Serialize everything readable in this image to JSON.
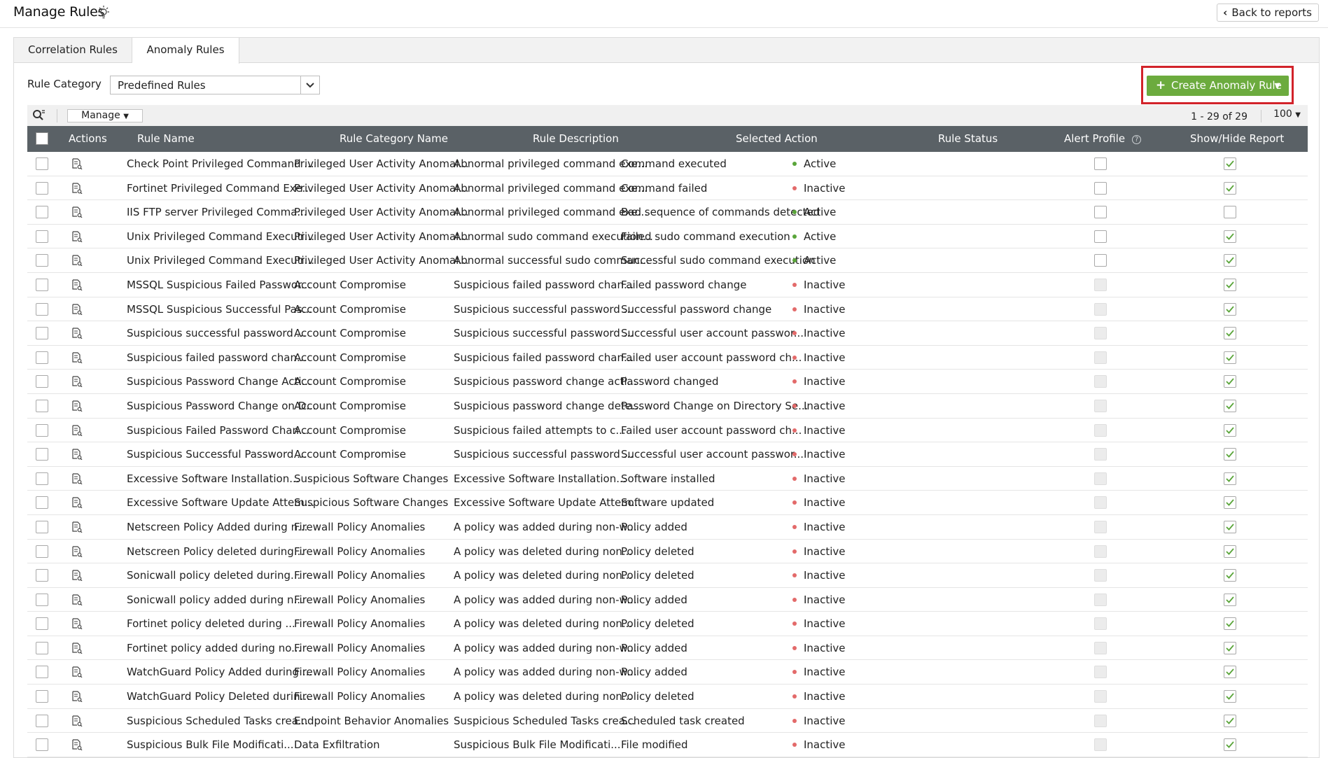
{
  "header": {
    "title": "Manage Rules",
    "back_label": "Back to reports"
  },
  "tabs": [
    {
      "label": "Correlation Rules",
      "active": false
    },
    {
      "label": "Anomaly Rules",
      "active": true
    }
  ],
  "filter": {
    "label": "Rule Category",
    "selected": "Predefined Rules"
  },
  "create_button": {
    "label": "Create Anomaly Rule",
    "color": "#6cab3e"
  },
  "toolbar": {
    "manage_label": "Manage",
    "pagination": "1 - 29 of 29",
    "per_page": "100"
  },
  "columns": {
    "actions": "Actions",
    "rule_name": "Rule Name",
    "category": "Rule Category Name",
    "description": "Rule Description",
    "action": "Selected Action",
    "status": "Rule Status",
    "alert": "Alert Profile",
    "show": "Show/Hide Report"
  },
  "colors": {
    "header_bg": "#5a6166",
    "active": "#5aa53a",
    "inactive": "#e36a6a",
    "check": "#5aa53a",
    "highlight": "#d2232a"
  },
  "rows": [
    {
      "name": "Check Point Privileged Command ...",
      "category": "Privileged User Activity Anomal...",
      "description": "Abnormal privileged command exe...",
      "action": "Command executed",
      "status": "Active",
      "alert_enabled": true,
      "show": true
    },
    {
      "name": "Fortinet Privileged Command Exe...",
      "category": "Privileged User Activity Anomal...",
      "description": "Abnormal privileged command exe...",
      "action": "Command failed",
      "status": "Inactive",
      "alert_enabled": true,
      "show": true
    },
    {
      "name": "IIS FTP server Privileged Comma...",
      "category": "Privileged User Activity Anomal...",
      "description": "Abnormal privileged command exe...",
      "action": "Bad sequence of commands detected",
      "status": "Active",
      "alert_enabled": true,
      "show": false
    },
    {
      "name": "Unix Privileged Command Executi...",
      "category": "Privileged User Activity Anomal...",
      "description": "Abnormal sudo command execution...",
      "action": "Failed sudo command execution",
      "status": "Active",
      "alert_enabled": true,
      "show": true
    },
    {
      "name": "Unix Privileged Command Executi...",
      "category": "Privileged User Activity Anomal...",
      "description": "Abnormal successful sudo comman...",
      "action": "Successful sudo command execution",
      "status": "Active",
      "alert_enabled": true,
      "show": true
    },
    {
      "name": "MSSQL Suspicious Failed Passwor...",
      "category": "Account Compromise",
      "description": "Suspicious failed password chan...",
      "action": "Failed password change",
      "status": "Inactive",
      "alert_enabled": false,
      "show": true
    },
    {
      "name": "MSSQL Suspicious Successful Pas...",
      "category": "Account Compromise",
      "description": "Suspicious successful password ...",
      "action": "Successful password change",
      "status": "Inactive",
      "alert_enabled": false,
      "show": true
    },
    {
      "name": "Suspicious successful password ...",
      "category": "Account Compromise",
      "description": "Suspicious successful password ...",
      "action": "Successful user account passwor...",
      "status": "Inactive",
      "alert_enabled": false,
      "show": true
    },
    {
      "name": "Suspicious failed password chan...",
      "category": "Account Compromise",
      "description": "Suspicious failed password chan...",
      "action": "Failed user account password ch...",
      "status": "Inactive",
      "alert_enabled": false,
      "show": true
    },
    {
      "name": "Suspicious Password Change Acti...",
      "category": "Account Compromise",
      "description": "Suspicious password change acti...",
      "action": "Password changed",
      "status": "Inactive",
      "alert_enabled": false,
      "show": true
    },
    {
      "name": "Suspicious Password Change on D...",
      "category": "Account Compromise",
      "description": "Suspicious password change dete...",
      "action": "Password Change on Directory Se...",
      "status": "Inactive",
      "alert_enabled": false,
      "show": true
    },
    {
      "name": "Suspicious Failed Password Chan...",
      "category": "Account Compromise",
      "description": "Suspicious failed attempts to c...",
      "action": "Failed user account password ch...",
      "status": "Inactive",
      "alert_enabled": false,
      "show": true
    },
    {
      "name": "Suspicious Successful Password ...",
      "category": "Account Compromise",
      "description": "Suspicious successful password ...",
      "action": "Successful user account passwor...",
      "status": "Inactive",
      "alert_enabled": false,
      "show": true
    },
    {
      "name": "Excessive Software Installation...",
      "category": "Suspicious Software Changes",
      "description": "Excessive Software Installation...",
      "action": "Software installed",
      "status": "Inactive",
      "alert_enabled": false,
      "show": true
    },
    {
      "name": "Excessive Software Update Attem...",
      "category": "Suspicious Software Changes",
      "description": "Excessive Software Update Attem...",
      "action": "Software updated",
      "status": "Inactive",
      "alert_enabled": false,
      "show": true
    },
    {
      "name": "Netscreen Policy Added during n...",
      "category": "Firewall Policy Anomalies",
      "description": "A policy was added during non-w...",
      "action": "Policy added",
      "status": "Inactive",
      "alert_enabled": false,
      "show": true
    },
    {
      "name": "Netscreen Policy deleted during...",
      "category": "Firewall Policy Anomalies",
      "description": "A policy was deleted during non...",
      "action": "Policy deleted",
      "status": "Inactive",
      "alert_enabled": false,
      "show": true
    },
    {
      "name": "Sonicwall policy deleted during...",
      "category": "Firewall Policy Anomalies",
      "description": "A policy was deleted during non...",
      "action": "Policy deleted",
      "status": "Inactive",
      "alert_enabled": false,
      "show": true
    },
    {
      "name": "Sonicwall policy added during n...",
      "category": "Firewall Policy Anomalies",
      "description": "A policy was added during non-w...",
      "action": "Policy added",
      "status": "Inactive",
      "alert_enabled": false,
      "show": true
    },
    {
      "name": "Fortinet policy deleted during ...",
      "category": "Firewall Policy Anomalies",
      "description": "A policy was deleted during non...",
      "action": "Policy deleted",
      "status": "Inactive",
      "alert_enabled": false,
      "show": true
    },
    {
      "name": "Fortinet policy added during no...",
      "category": "Firewall Policy Anomalies",
      "description": "A policy was added during non-w...",
      "action": "Policy added",
      "status": "Inactive",
      "alert_enabled": false,
      "show": true
    },
    {
      "name": "WatchGuard Policy Added during ...",
      "category": "Firewall Policy Anomalies",
      "description": "A policy was added during non-w...",
      "action": "Policy added",
      "status": "Inactive",
      "alert_enabled": false,
      "show": true
    },
    {
      "name": "WatchGuard Policy Deleted durin...",
      "category": "Firewall Policy Anomalies",
      "description": "A policy was deleted during non...",
      "action": "Policy deleted",
      "status": "Inactive",
      "alert_enabled": false,
      "show": true
    },
    {
      "name": "Suspicious Scheduled Tasks crea...",
      "category": "Endpoint Behavior Anomalies",
      "description": "Suspicious Scheduled Tasks crea...",
      "action": "Scheduled task created",
      "status": "Inactive",
      "alert_enabled": false,
      "show": true
    },
    {
      "name": "Suspicious Bulk File Modificati...",
      "category": "Data Exfiltration",
      "description": "Suspicious Bulk File Modificati...",
      "action": "File modified",
      "status": "Inactive",
      "alert_enabled": false,
      "show": true
    }
  ]
}
